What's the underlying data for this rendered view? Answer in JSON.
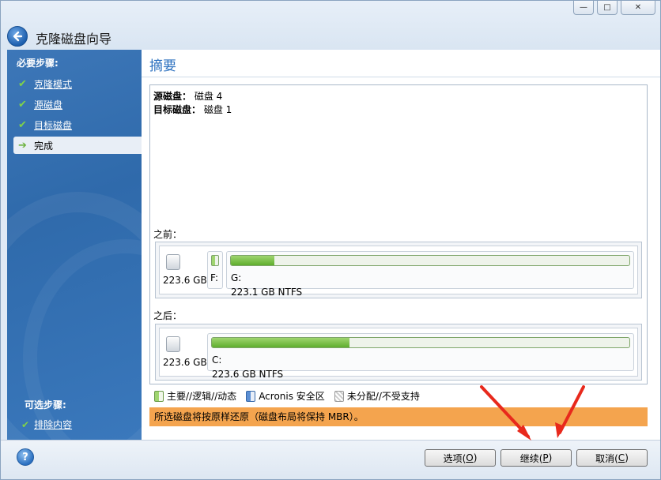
{
  "window": {
    "title": "克隆磁盘向导",
    "controls": {
      "minimize": "—",
      "maximize": "□",
      "close": "✕"
    }
  },
  "sidebar": {
    "required_header": "必要步骤:",
    "steps": [
      {
        "label": "克隆模式",
        "done": true
      },
      {
        "label": "源磁盘",
        "done": true
      },
      {
        "label": "目标磁盘",
        "done": true
      },
      {
        "label": "完成",
        "current": true
      }
    ],
    "optional_header": "可选步骤:",
    "optional_steps": [
      {
        "label": "排除内容"
      }
    ]
  },
  "main": {
    "title": "摘要",
    "source_label": "源磁盘：",
    "source_value": "磁盘 4",
    "target_label": "目标磁盘：",
    "target_value": "磁盘 1",
    "before_label": "之前：",
    "after_label": "之后：",
    "before_disk": {
      "size": "223.6 GB",
      "small_partition": {
        "letter": "F:"
      },
      "partition": {
        "letter": "G:",
        "info": "223.1 GB  NTFS",
        "fill_fraction": 0.11
      }
    },
    "after_disk": {
      "size": "223.6 GB",
      "partition": {
        "letter": "C:",
        "info": "223.6 GB  NTFS",
        "fill_fraction": 0.33
      }
    },
    "legend": {
      "primary": "主要//逻辑//动态",
      "acronis": "Acronis 安全区",
      "unallocated": "未分配//不受支持"
    },
    "warning": "所选磁盘将按原样还原（磁盘布局将保持 MBR）。"
  },
  "footer": {
    "help_icon": "?",
    "options_label": "选项(",
    "options_key": "O",
    "continue_label": "继续(",
    "continue_key": "P",
    "cancel_label": "取消(",
    "cancel_key": "C",
    "close_paren": ")"
  },
  "colors": {
    "accent": "#2a6fbf",
    "warning_bg": "#f4a44e",
    "annotation_arrow": "#e8291c"
  }
}
